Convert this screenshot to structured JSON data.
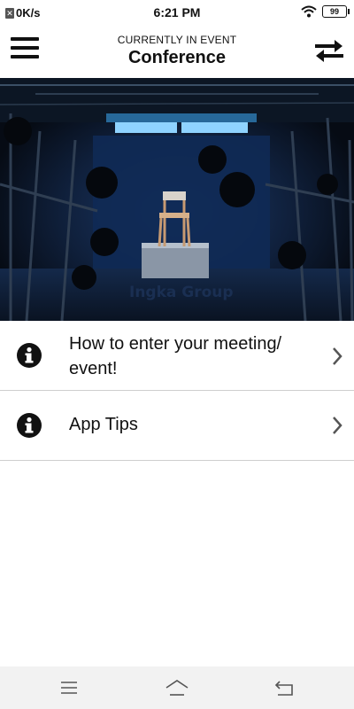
{
  "status_bar": {
    "network_speed": "0K/s",
    "time": "6:21 PM",
    "battery": "99",
    "icons": [
      "notification-x-icon",
      "wifi-icon",
      "battery-icon"
    ]
  },
  "header": {
    "subtitle": "CURRENTLY IN EVENT",
    "title": "Conference",
    "menu_icon": "hamburger-menu-icon",
    "switch_icon": "switch-arrows-icon"
  },
  "banner": {
    "overlay_text": "Ingka Group"
  },
  "list": [
    {
      "label": "How to enter your meeting/ event!",
      "icon": "info-icon"
    },
    {
      "label": "App Tips",
      "icon": "info-icon"
    }
  ],
  "nav_bar": {
    "icons": [
      "recents-icon",
      "home-icon",
      "back-icon"
    ]
  },
  "colors": {
    "text": "#111111",
    "divider": "#cfcfcf",
    "navbar_bg": "#f2f2f2",
    "banner_dark": "#0b1522",
    "light_glow": "#8fd3ff"
  }
}
